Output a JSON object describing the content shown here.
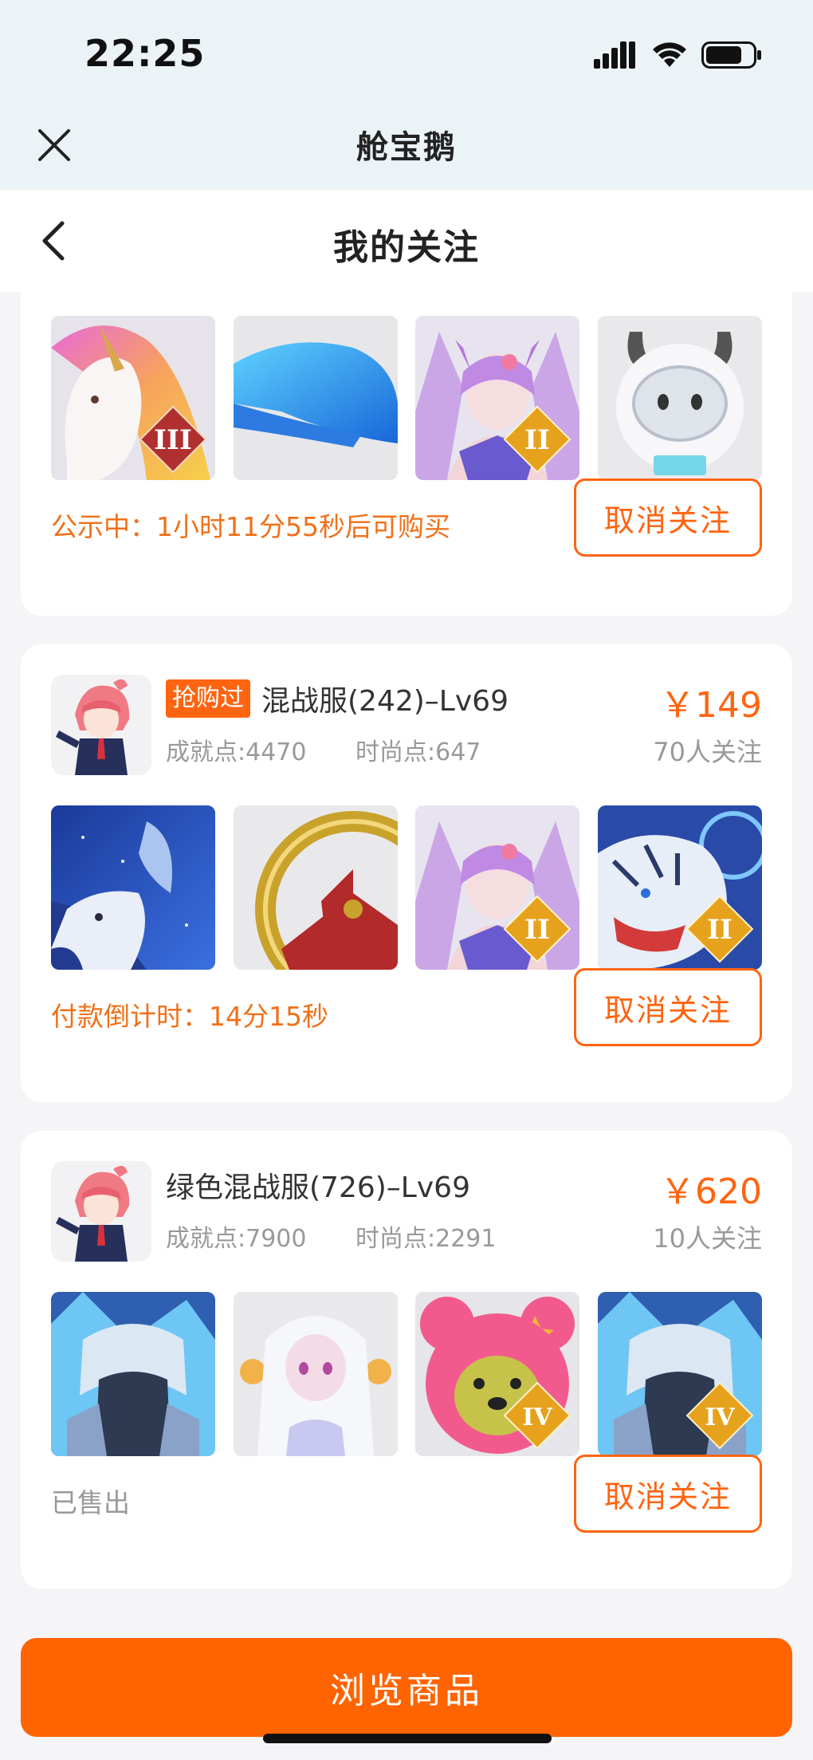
{
  "status_bar": {
    "time": "22:25"
  },
  "mini_header": {
    "title": "舱宝鹅"
  },
  "page": {
    "title": "我的关注"
  },
  "cards": [
    {
      "items": [
        {
          "icon": "unicorn-mount",
          "badge": "III"
        },
        {
          "icon": "blue-whale-wing",
          "badge": ""
        },
        {
          "icon": "fox-spirit-girl",
          "badge": "II"
        },
        {
          "icon": "white-cow-robot",
          "badge": ""
        }
      ],
      "status": "公示中：1小时11分55秒后可购买",
      "button": "取消关注"
    },
    {
      "tag": "抢购过",
      "server": "混战服(242)–Lv69",
      "achievement": "成就点:4470",
      "fashion": "时尚点:647",
      "price": "￥149",
      "followers": "70人关注",
      "items": [
        {
          "icon": "starry-deer-mount",
          "badge": ""
        },
        {
          "icon": "golden-ring-emblem",
          "badge": ""
        },
        {
          "icon": "fox-spirit-girl",
          "badge": "II"
        },
        {
          "icon": "white-tiger-mount",
          "badge": "II"
        }
      ],
      "status": "付款倒计时：14分15秒",
      "button": "取消关注"
    },
    {
      "server": "绿色混战服(726)–Lv69",
      "achievement": "成就点:7900",
      "fashion": "时尚点:2291",
      "price": "￥620",
      "followers": "10人关注",
      "items": [
        {
          "icon": "ice-armor-warrior",
          "badge": ""
        },
        {
          "icon": "white-haired-doll",
          "badge": ""
        },
        {
          "icon": "pink-bear-costume",
          "badge": "IV"
        },
        {
          "icon": "ice-armor-warrior",
          "badge": "IV"
        }
      ],
      "status": "已售出",
      "button": "取消关注"
    }
  ],
  "bottom": {
    "browse_button": "浏览商品"
  },
  "colors": {
    "accent": "#ff6410",
    "status_orange": "#f07018",
    "muted": "#999999"
  }
}
